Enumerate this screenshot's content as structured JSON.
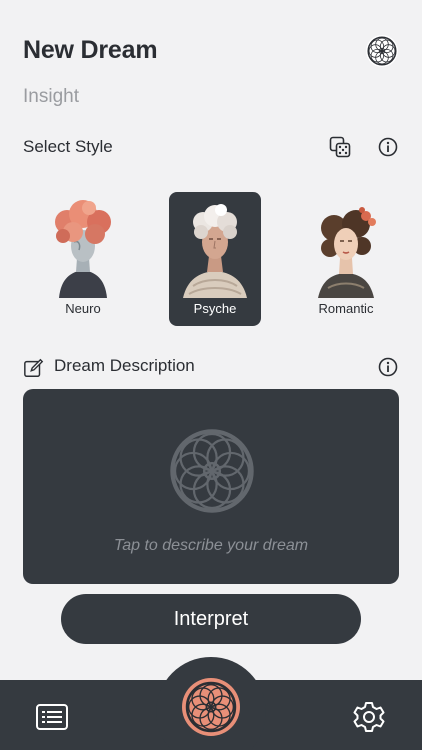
{
  "header": {
    "title": "New Dream",
    "subtitle": "Insight"
  },
  "style_section": {
    "label": "Select Style",
    "styles": [
      {
        "label": "Neuro",
        "selected": false
      },
      {
        "label": "Psyche",
        "selected": true
      },
      {
        "label": "Romantic",
        "selected": false
      }
    ]
  },
  "description": {
    "label": "Dream Description",
    "placeholder": "Tap to describe your dream"
  },
  "actions": {
    "interpret_label": "Interpret"
  },
  "icons": {
    "logo": "dreamcatcher-icon",
    "random": "dice-icon",
    "info": "info-icon",
    "edit": "edit-icon",
    "journal": "list-icon",
    "settings": "gear-icon"
  },
  "colors": {
    "dark_surface": "#353a40",
    "background": "#f2f2f3",
    "accent": "#e88f78"
  }
}
